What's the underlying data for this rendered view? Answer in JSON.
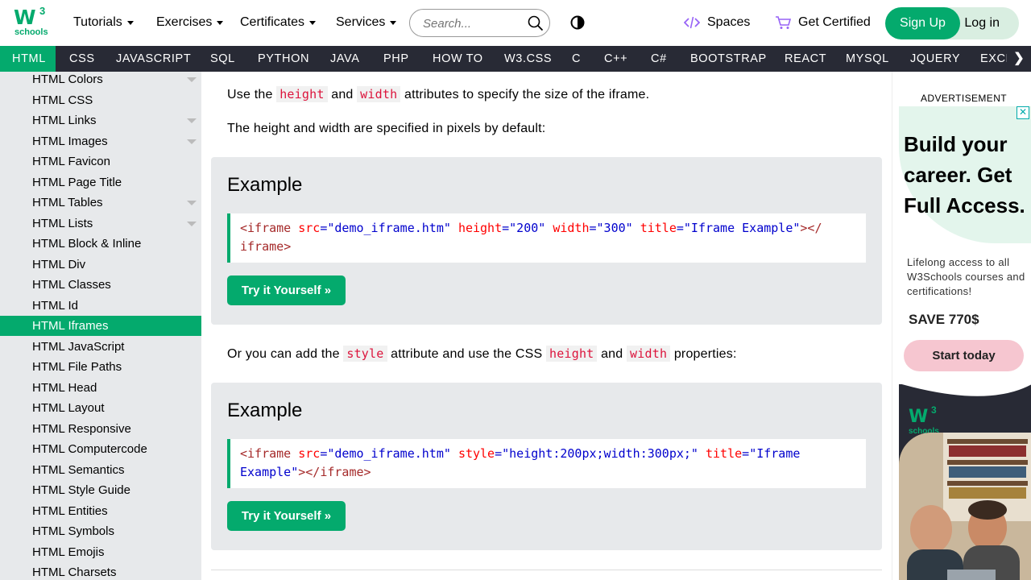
{
  "topbar": {
    "logo_text": "W3",
    "logo_sup": "3",
    "logo_sub": "schools",
    "menus": [
      "Tutorials",
      "Exercises",
      "Certificates",
      "Services"
    ],
    "search_placeholder": "Search...",
    "spaces_label": "Spaces",
    "certified_label": "Get Certified",
    "signup_label": "Sign Up",
    "login_label": "Log in"
  },
  "navbar": {
    "items": [
      "HTML",
      "CSS",
      "JAVASCRIPT",
      "SQL",
      "PYTHON",
      "JAVA",
      "PHP",
      "HOW TO",
      "W3.CSS",
      "C",
      "C++",
      "C#",
      "BOOTSTRAP",
      "REACT",
      "MYSQL",
      "JQUERY",
      "EXCE"
    ],
    "active": "HTML",
    "more_arrow": "❯"
  },
  "sidebar": {
    "items": [
      {
        "label": "HTML Colors",
        "expandable": true
      },
      {
        "label": "HTML CSS",
        "expandable": false
      },
      {
        "label": "HTML Links",
        "expandable": true
      },
      {
        "label": "HTML Images",
        "expandable": true
      },
      {
        "label": "HTML Favicon",
        "expandable": false
      },
      {
        "label": "HTML Page Title",
        "expandable": false
      },
      {
        "label": "HTML Tables",
        "expandable": true
      },
      {
        "label": "HTML Lists",
        "expandable": true
      },
      {
        "label": "HTML Block & Inline",
        "expandable": false
      },
      {
        "label": "HTML Div",
        "expandable": false
      },
      {
        "label": "HTML Classes",
        "expandable": false
      },
      {
        "label": "HTML Id",
        "expandable": false
      },
      {
        "label": "HTML Iframes",
        "expandable": false,
        "active": true
      },
      {
        "label": "HTML JavaScript",
        "expandable": false
      },
      {
        "label": "HTML File Paths",
        "expandable": false
      },
      {
        "label": "HTML Head",
        "expandable": false
      },
      {
        "label": "HTML Layout",
        "expandable": false
      },
      {
        "label": "HTML Responsive",
        "expandable": false
      },
      {
        "label": "HTML Computercode",
        "expandable": false
      },
      {
        "label": "HTML Semantics",
        "expandable": false
      },
      {
        "label": "HTML Style Guide",
        "expandable": false
      },
      {
        "label": "HTML Entities",
        "expandable": false
      },
      {
        "label": "HTML Symbols",
        "expandable": false
      },
      {
        "label": "HTML Emojis",
        "expandable": false
      },
      {
        "label": "HTML Charsets",
        "expandable": false
      }
    ]
  },
  "main": {
    "p1": {
      "before": "Use the ",
      "code1": "height",
      "mid": " and ",
      "code2": "width",
      "after": " attributes to specify the size of the iframe."
    },
    "p2": "The height and width are specified in pixels by default:",
    "example1": {
      "heading": "Example",
      "line1": {
        "open": "<iframe",
        "a1": "src",
        "v1": "\"demo_iframe.htm\"",
        "a2": "height",
        "v2": "\"200\"",
        "a3": "width",
        "v3": "\"300\"",
        "a4": "title",
        "v4": "\"Iframe Example\"",
        "close": "></"
      },
      "line2": {
        "tag": "iframe",
        "end": ">"
      },
      "button": "Try it Yourself »"
    },
    "p3": {
      "before": "Or you can add the ",
      "code1": "style",
      "mid1": " attribute and use the CSS ",
      "code2": "height",
      "mid2": " and ",
      "code3": "width",
      "after": " properties:"
    },
    "example2": {
      "heading": "Example",
      "line1": {
        "open": "<iframe",
        "a1": "src",
        "v1": "\"demo_iframe.htm\"",
        "a2": "style",
        "v2": "\"height:200px;width:300px;\"",
        "a3": "title",
        "v3": "\"Iframe"
      },
      "line2": {
        "v3b": "Example\"",
        "close": "></",
        "tag": "iframe",
        "end": ">"
      },
      "button": "Try it Yourself »"
    }
  },
  "ad": {
    "label": "ADVERTISEMENT",
    "close": "✕",
    "headline": "Build your career. Get Full Access.",
    "sub": "Lifelong access to all W3Schools courses and certifications!",
    "save": "SAVE 770$",
    "cta": "Start today",
    "logo_text": "W3",
    "logo_sup": "3",
    "logo_sub": "schools"
  },
  "colors": {
    "brand_green": "#04AA6D",
    "nav_dark": "#282A35",
    "sidebar_bg": "#E7E9EB",
    "code_red": "#DC143C"
  }
}
